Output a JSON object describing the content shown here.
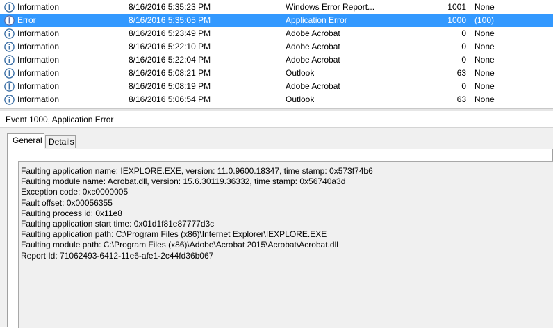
{
  "events": [
    {
      "level": "Information",
      "icon": "info-icon",
      "date": "8/16/2016 5:35:23 PM",
      "source": "Windows Error Report...",
      "event_id": "1001",
      "task": "None",
      "selected": false
    },
    {
      "level": "Error",
      "icon": "error-icon",
      "date": "8/16/2016 5:35:05 PM",
      "source": "Application Error",
      "event_id": "1000",
      "task": "(100)",
      "selected": true
    },
    {
      "level": "Information",
      "icon": "info-icon",
      "date": "8/16/2016 5:23:49 PM",
      "source": "Adobe Acrobat",
      "event_id": "0",
      "task": "None",
      "selected": false
    },
    {
      "level": "Information",
      "icon": "info-icon",
      "date": "8/16/2016 5:22:10 PM",
      "source": "Adobe Acrobat",
      "event_id": "0",
      "task": "None",
      "selected": false
    },
    {
      "level": "Information",
      "icon": "info-icon",
      "date": "8/16/2016 5:22:04 PM",
      "source": "Adobe Acrobat",
      "event_id": "0",
      "task": "None",
      "selected": false
    },
    {
      "level": "Information",
      "icon": "info-icon",
      "date": "8/16/2016 5:08:21 PM",
      "source": "Outlook",
      "event_id": "63",
      "task": "None",
      "selected": false
    },
    {
      "level": "Information",
      "icon": "info-icon",
      "date": "8/16/2016 5:08:19 PM",
      "source": "Adobe Acrobat",
      "event_id": "0",
      "task": "None",
      "selected": false
    },
    {
      "level": "Information",
      "icon": "info-icon",
      "date": "8/16/2016 5:06:54 PM",
      "source": "Outlook",
      "event_id": "63",
      "task": "None",
      "selected": false
    }
  ],
  "detail": {
    "header": "Event 1000, Application Error",
    "tabs": {
      "general": "General",
      "details": "Details"
    },
    "message_lines": [
      "Faulting application name: IEXPLORE.EXE, version: 11.0.9600.18347, time stamp: 0x573f74b6",
      "Faulting module name: Acrobat.dll, version: 15.6.30119.36332, time stamp: 0x56740a3d",
      "Exception code: 0xc0000005",
      "Fault offset: 0x00056355",
      "Faulting process id: 0x11e8",
      "Faulting application start time: 0x01d1f81e87777d3c",
      "Faulting application path: C:\\Program Files (x86)\\Internet Explorer\\IEXPLORE.EXE",
      "Faulting module path: C:\\Program Files (x86)\\Adobe\\Acrobat 2015\\Acrobat\\Acrobat.dll",
      "Report Id: 71062493-6412-11e6-afe1-2c44fd36b067"
    ]
  },
  "colors": {
    "selection": "#3399ff",
    "info_icon": "#3a6ea5",
    "error_icon": "#5a6ea8"
  }
}
